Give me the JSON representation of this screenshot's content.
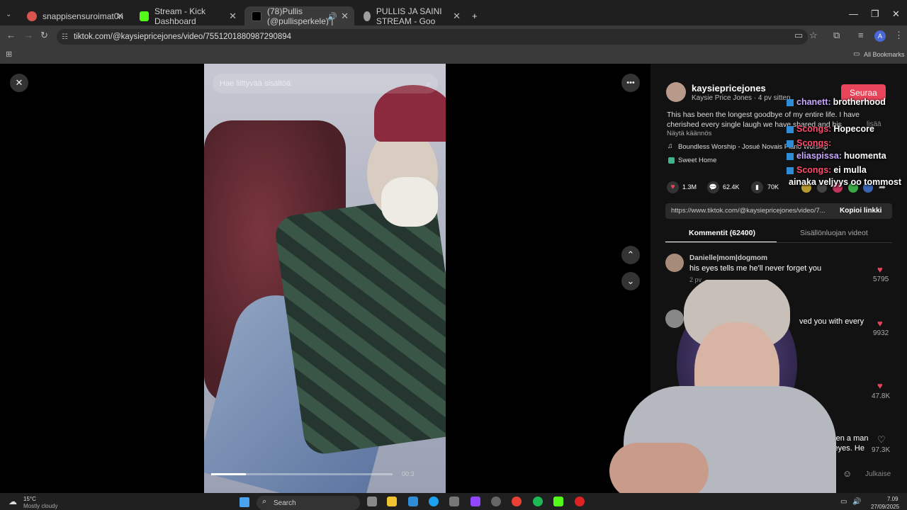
{
  "browser": {
    "tabs": [
      {
        "title": "snappisensuroimat0n",
        "color": "#d9534f"
      },
      {
        "title": "Stream - Kick Dashboard",
        "color": "#53fc18"
      },
      {
        "title": "(78)Pullis (@pullisperkele) |",
        "color": "#000000"
      },
      {
        "title": "PULLIS JA SAINI STREAM - Goo",
        "color": "#9e9e9e"
      }
    ],
    "url": "tiktok.com/@kaysiepricejones/video/7551201880987290894",
    "all_bookmarks": "All Bookmarks"
  },
  "video": {
    "search_placeholder": "Hae liittyvää sisältöä",
    "timecode": "00:3",
    "progress": 0.19
  },
  "post": {
    "username": "kaysiepricejones",
    "display": "Kaysie Price Jones · 4 pv sitten",
    "follow": "Seuraa",
    "caption_line1": "This has been the longest goodbye of my entire life. I have",
    "caption_line2": "cherished every single laugh we have shared and his",
    "more": "lisää",
    "translate": "Näytä käännös",
    "music": "Boundless Worship - Josué Novais Piano Worship",
    "tag": "Sweet Home",
    "likes": "1.3M",
    "comments_count": "62.4K",
    "saves": "70K",
    "link": "https://www.tiktok.com/@kaysiepricejones/video/7...",
    "copy_link": "Kopioi linkki",
    "tab_comments": "Kommentit (62400)",
    "tab_creator": "Sisällönluojan videot"
  },
  "comments": [
    {
      "user": "Danielle|mom|dogmom",
      "text": "his eyes tells me he'll never forget you",
      "meta": "2 pv",
      "likes": "5795"
    },
    {
      "user": "",
      "text": "ved you with every",
      "meta": "",
      "likes": "9932"
    },
    {
      "user": "",
      "text": "",
      "meta": "",
      "likes": "47.8K"
    },
    {
      "user": "",
      "text": "seen a man",
      "text2": "s eyes. He",
      "meta": "",
      "likes": "97.3K"
    }
  ],
  "comment_post": "Julkaise",
  "chat": [
    {
      "user": "chanett:",
      "msg": "brotherhood",
      "color": "#c9a7ff"
    },
    {
      "user": "Scongs:",
      "msg": "Hopecore",
      "color": "#ff4d6d"
    },
    {
      "user": "Scongs:",
      "msg": "",
      "color": "#ff4d6d"
    },
    {
      "user": "eliaspissa:",
      "msg": "huomenta",
      "color": "#c9a7ff"
    },
    {
      "user": "Scongs:",
      "msg": "ei mulla",
      "color": "#ff4d6d"
    },
    {
      "user": "",
      "msg": "ainaka veljyys oo tommost",
      "color": "#ffffff"
    }
  ],
  "taskbar": {
    "temp": "15°C",
    "weather": "Mostly cloudy",
    "search": "Search",
    "time": "7.09",
    "date": "27/09/2025"
  }
}
